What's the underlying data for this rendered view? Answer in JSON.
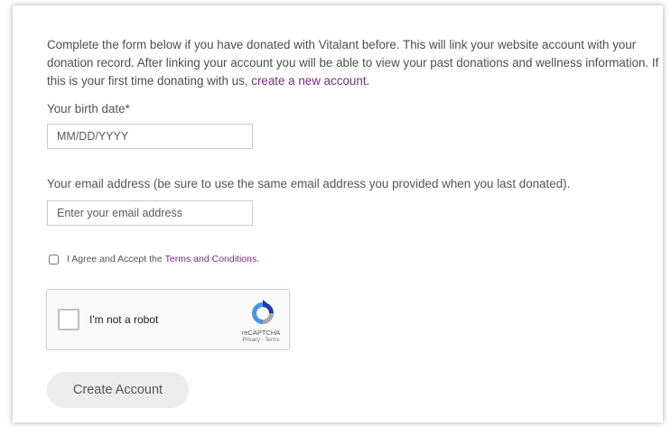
{
  "intro": {
    "text": "Complete the form below if you have donated with Vitalant before. This will link your website account with your donation record. After linking your account you will be able to view your past donations and wellness information. If this is your first time donating with us, ",
    "link": "create a new account."
  },
  "birth_date": {
    "label": "Your birth date*",
    "placeholder": "MM/DD/YYYY"
  },
  "email": {
    "label": "Your email address (be sure to use the same email address you provided when you last donated).",
    "placeholder": "Enter your email address"
  },
  "agree": {
    "text": "I Agree and Accept the",
    "link": "Terms and Conditions."
  },
  "captcha": {
    "label": "I'm not a robot",
    "brand": "reCAPTCHA",
    "links": "Privacy - Terms",
    "logo_icon": "recaptcha-logo-icon"
  },
  "submit": {
    "label": "Create Account"
  }
}
